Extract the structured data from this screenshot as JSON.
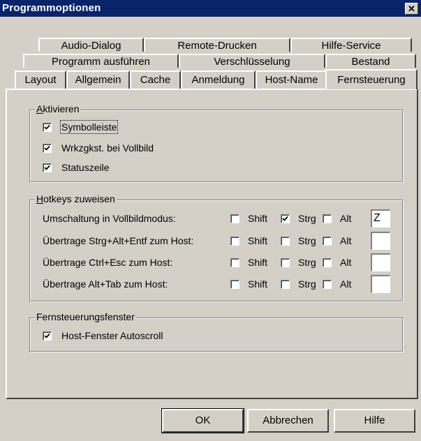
{
  "window": {
    "title": "Programmoptionen",
    "close_label": "✕"
  },
  "tabs": {
    "row1": [
      "Audio-Dialog",
      "Remote-Drucken",
      "Hilfe-Service"
    ],
    "row2": [
      "Programm ausführen",
      "Verschlüsselung",
      "Bestand"
    ],
    "row3": [
      "Layout",
      "Allgemein",
      "Cache",
      "Anmeldung",
      "Host-Name",
      "Fernsteuerung"
    ],
    "active": "Fernsteuerung"
  },
  "aktivieren": {
    "legend_prefix": "A",
    "legend_rest": "ktivieren",
    "items": [
      {
        "label": "Symbolleiste",
        "checked": true
      },
      {
        "label": "Wrkzgkst. bei Vollbild",
        "checked": true
      },
      {
        "label": "Statuszeile",
        "checked": true
      }
    ]
  },
  "hotkeys": {
    "legend_prefix": "H",
    "legend_rest": "otkeys zuweisen",
    "modifier_labels": {
      "shift": "Shift",
      "strg": "Strg",
      "alt": "Alt"
    },
    "rows": [
      {
        "label": "Umschaltung in Vollbildmodus:",
        "shift": false,
        "strg": true,
        "alt": false,
        "key": "Z"
      },
      {
        "label": "Übertrage Strg+Alt+Entf zum Host:",
        "shift": false,
        "strg": false,
        "alt": false,
        "key": ""
      },
      {
        "label": "Übertrage Ctrl+Esc zum Host:",
        "shift": false,
        "strg": false,
        "alt": false,
        "key": ""
      },
      {
        "label": "Übertrage Alt+Tab zum Host:",
        "shift": false,
        "strg": false,
        "alt": false,
        "key": ""
      }
    ]
  },
  "fernsteuerungsfenster": {
    "legend": "Fernsteuerungsfenster",
    "items": [
      {
        "label": "Host-Fenster Autoscroll",
        "checked": true
      }
    ]
  },
  "buttons": {
    "ok": "OK",
    "cancel": "Abbrechen",
    "help": "Hilfe"
  }
}
